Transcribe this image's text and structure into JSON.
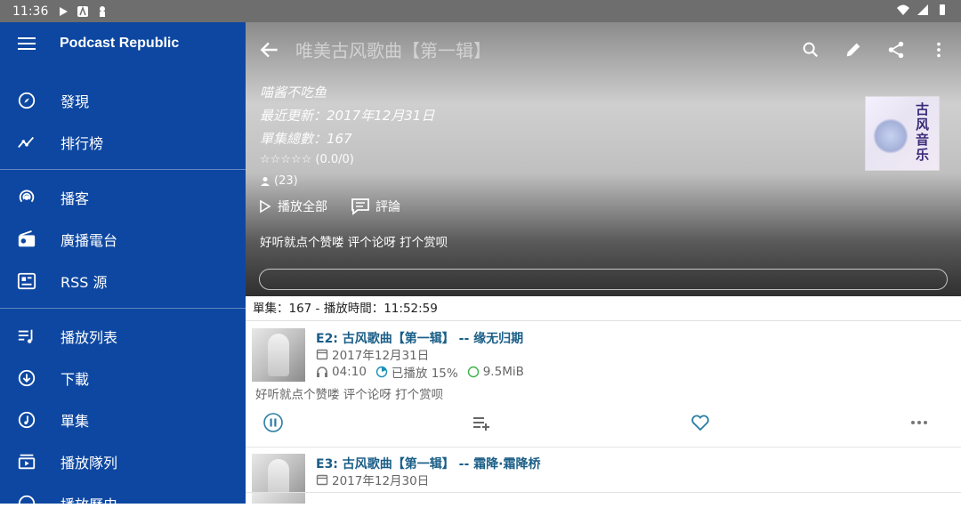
{
  "status": {
    "time": "11:36"
  },
  "drawer": {
    "title": "Podcast Republic",
    "items": [
      {
        "label": "發現"
      },
      {
        "label": "排行榜"
      },
      {
        "label": "播客"
      },
      {
        "label": "廣播電台"
      },
      {
        "label": "RSS 源"
      },
      {
        "label": "播放列表"
      },
      {
        "label": "下載"
      },
      {
        "label": "單集"
      },
      {
        "label": "播放隊列"
      },
      {
        "label": "播放歷史"
      }
    ]
  },
  "podcast": {
    "title": "唯美古风歌曲【第一辑】",
    "author": "喵酱不吃鱼",
    "last_update": "最近更新：2017年12月31日",
    "episode_total": "單集總數：167",
    "rating": "☆☆☆☆☆ (0.0/0)",
    "subscribers": "(23)",
    "cover_text": "古风音乐",
    "play_all": "播放全部",
    "comments": "評論",
    "tagline": "好听就点个赞喽  评个论呀  打个赏呗"
  },
  "summary": "單集：167 - 播放時間：11:52:59",
  "episodes": [
    {
      "title": "E2: 古风歌曲【第一辑】 -- 缘无归期",
      "date": "2017年12月31日",
      "duration": "04:10",
      "played": "已播放 15%",
      "size": "9.5MiB",
      "desc": "好听就点个赞喽  评个论呀  打个赏呗"
    },
    {
      "title": "E3: 古风歌曲【第一辑】 -- 霜降·霜降桥",
      "date": "2017年12月30日"
    }
  ],
  "colors": {
    "drawer": "#0d47a1",
    "accent": "#1a5e87",
    "status_bar": "#6e6e6e"
  }
}
